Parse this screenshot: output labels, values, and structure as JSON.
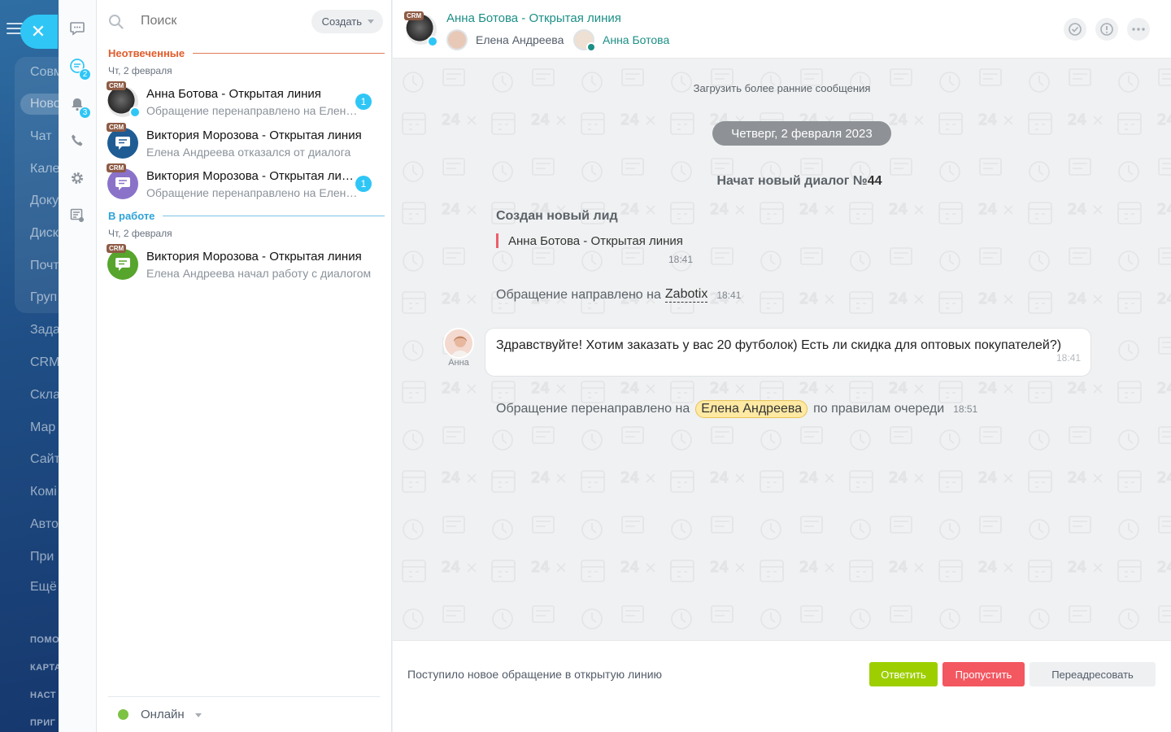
{
  "portal_menu": {
    "items": [
      "Совм",
      "Ново",
      "Чат",
      "Кале",
      "Доку",
      "Диск",
      "Почт",
      "Груп",
      "Зада",
      "CRM",
      "Скла",
      "Мар",
      "Сайт",
      "Комі",
      "Авто",
      "При",
      "Ещё"
    ],
    "active_index": 1,
    "small_items": [
      "ПОМО",
      "КАРТА",
      "НАСТ",
      "ПРИГ"
    ]
  },
  "rail": {
    "badges": {
      "openlines": "2",
      "notifications": "3"
    }
  },
  "recent": {
    "search_placeholder": "Поиск",
    "create_label": "Создать",
    "groups": [
      {
        "title": "Неотвеченные",
        "color": "#e05d2c",
        "date": "Чт, 2 февраля",
        "items": [
          {
            "crm": "CRM",
            "title": "Анна Ботова - Открытая линия",
            "subtitle": "Обращение перенаправлено на Елена Андреева",
            "counter": "1"
          },
          {
            "crm": "CRM",
            "title": "Виктория Морозова - Открытая линия",
            "subtitle": "Елена Андреева отказался от диалога",
            "counter": ""
          },
          {
            "crm": "CRM",
            "title": "Виктория Морозова - Открытая линия",
            "subtitle": "Обращение перенаправлено на Елена Андреева",
            "counter": "1"
          }
        ]
      },
      {
        "title": "В работе",
        "color": "#2fa3d6",
        "date": "Чт, 2 февраля",
        "items": [
          {
            "crm": "CRM",
            "title": "Виктория Морозова - Открытая линия",
            "subtitle": "Елена Андреева начал работу с диалогом",
            "counter": ""
          }
        ]
      }
    ],
    "status": "Онлайн"
  },
  "dialog": {
    "crm": "CRM",
    "title": "Анна Ботова - Открытая линия",
    "members": [
      "Елена Андреева",
      "Анна Ботова"
    ],
    "load_earlier": "Загрузить более ранние сообщения",
    "date": "Четверг, 2 февраля 2023",
    "new_dialog_prefix": "Начат новый диалог №",
    "new_dialog_number": "44",
    "lead": {
      "title": "Создан новый лид",
      "name": "Анна Ботова - Открытая линия",
      "time": "18:41"
    },
    "routed": {
      "text": "Обращение направлено на",
      "link": "Zabotix",
      "time": "18:41"
    },
    "message": {
      "author": "Анна",
      "text": "Здравствуйте! Хотим заказать у вас 20 футболок) Есть ли скидка для оптовых покупателей?)",
      "time": "18:41"
    },
    "redirected": {
      "prefix": "Обращение перенаправлено на",
      "person": "Елена Андреева",
      "suffix": "по правилам очереди",
      "time": "18:51"
    },
    "footer": {
      "notice": "Поступило новое обращение в открытую линию",
      "answer": "Ответить",
      "skip": "Пропустить",
      "forward": "Переадресовать"
    }
  },
  "colors": {
    "accent": "#2fc6f6",
    "title_teal": "#1c8f86",
    "answer": "#9dcf00",
    "skip": "#f35760"
  }
}
